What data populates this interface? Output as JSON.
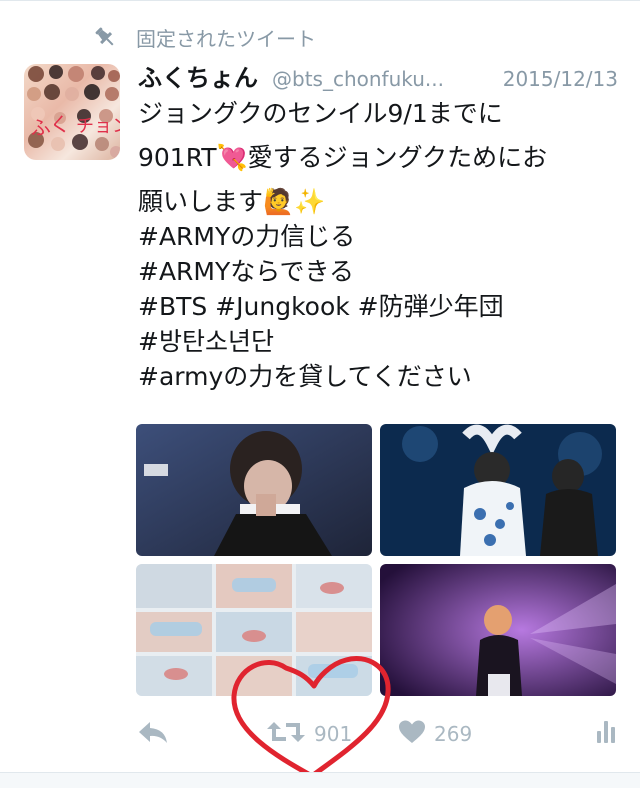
{
  "pinned_label": "固定されたツイート",
  "tweet": {
    "display_name": "ふくちょん",
    "handle": "@bts_chonfuku...",
    "date": "2015/12/13",
    "lines": [
      "ジョングクのセンイル9/1までに",
      "901RT💘愛するジョングクためにお",
      "願いします🙋✨",
      "#ARMYの力信じる",
      "#ARMYならできる",
      "#BTS #Jungkook #防弾少年団",
      "#방탄소년단",
      "#armyの力を貸してください"
    ]
  },
  "actions": {
    "retweet_count": "901",
    "like_count": "269"
  },
  "colors": {
    "muted": "#8899a6",
    "action_gray": "#aab8c2",
    "marker_red": "#e0242f"
  },
  "icons": [
    "pin-icon",
    "reply-icon",
    "retweet-icon",
    "heart-icon",
    "analytics-icon"
  ]
}
